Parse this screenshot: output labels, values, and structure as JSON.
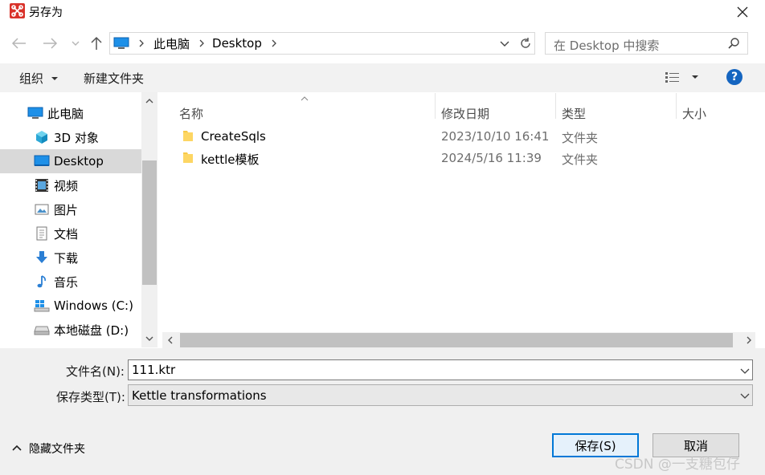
{
  "window": {
    "title": "另存为"
  },
  "nav": {
    "address": {
      "root": "此电脑",
      "current": "Desktop"
    },
    "search": {
      "placeholder": "在 Desktop 中搜索"
    }
  },
  "toolbar": {
    "organize": "组织",
    "new_folder": "新建文件夹"
  },
  "sidebar": {
    "items": [
      {
        "label": "此电脑",
        "icon": "pc-icon"
      },
      {
        "label": "3D 对象",
        "icon": "cube-icon"
      },
      {
        "label": "Desktop",
        "icon": "desktop-icon",
        "selected": true
      },
      {
        "label": "视频",
        "icon": "video-icon"
      },
      {
        "label": "图片",
        "icon": "picture-icon"
      },
      {
        "label": "文档",
        "icon": "document-icon"
      },
      {
        "label": "下载",
        "icon": "download-icon"
      },
      {
        "label": "音乐",
        "icon": "music-icon"
      },
      {
        "label": "Windows (C:)",
        "icon": "windows-drive-icon"
      },
      {
        "label": "本地磁盘 (D:)",
        "icon": "drive-icon"
      }
    ]
  },
  "file_list": {
    "columns": {
      "name": "名称",
      "modified": "修改日期",
      "type": "类型",
      "size": "大小"
    },
    "rows": [
      {
        "name": "CreateSqls",
        "modified": "2023/10/10 16:41",
        "type": "文件夹"
      },
      {
        "name": "kettle模板",
        "modified": "2024/5/16 11:39",
        "type": "文件夹"
      }
    ]
  },
  "form": {
    "filename_label": "文件名(N):",
    "filename_value": "111.ktr",
    "filetype_label": "保存类型(T):",
    "filetype_value": "Kettle transformations"
  },
  "footer": {
    "hide_folders": "隐藏文件夹",
    "save": "保存(S)",
    "cancel": "取消"
  },
  "watermark": "CSDN @一支糖包仔",
  "colors": {
    "accent": "#0078d7",
    "folder": "#f7c948",
    "help": "#1565c0"
  }
}
